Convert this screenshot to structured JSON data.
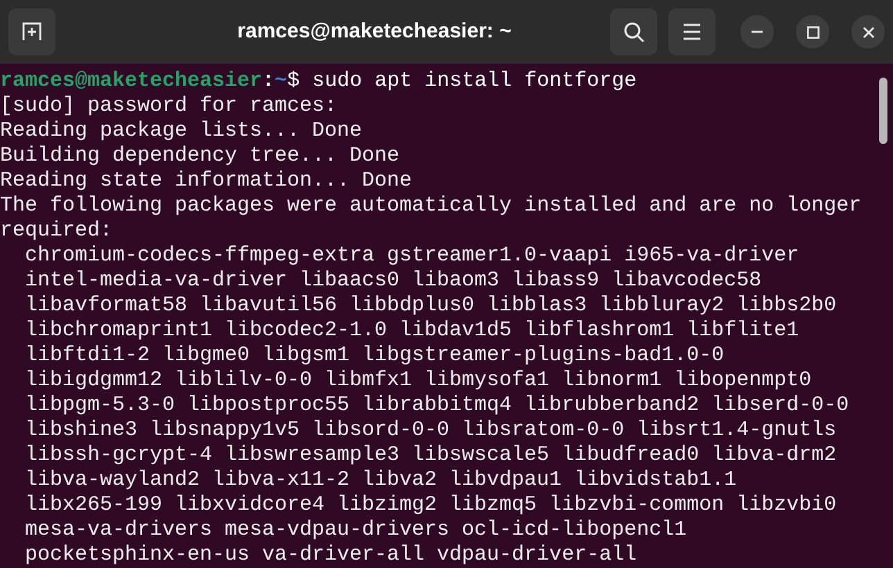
{
  "window": {
    "title": "ramces@maketecheasier: ~"
  },
  "prompt": {
    "user_host": "ramces@maketecheasier",
    "separator": ":",
    "path": "~",
    "symbol": "$",
    "command": "sudo apt install fontforge"
  },
  "output_lines": [
    "[sudo] password for ramces:",
    "Reading package lists... Done",
    "Building dependency tree... Done",
    "Reading state information... Done",
    "The following packages were automatically installed and are no longer",
    "required:"
  ],
  "package_lines": [
    "chromium-codecs-ffmpeg-extra gstreamer1.0-vaapi i965-va-driver",
    "intel-media-va-driver libaacs0 libaom3 libass9 libavcodec58",
    "libavformat58 libavutil56 libbdplus0 libblas3 libbluray2 libbs2b0",
    "libchromaprint1 libcodec2-1.0 libdav1d5 libflashrom1 libflite1",
    "libftdi1-2 libgme0 libgsm1 libgstreamer-plugins-bad1.0-0",
    "libigdgmm12 liblilv-0-0 libmfx1 libmysofa1 libnorm1 libopenmpt0",
    "libpgm-5.3-0 libpostproc55 librabbitmq4 librubberband2 libserd-0-0",
    "libshine3 libsnappy1v5 libsord-0-0 libsratom-0-0 libsrt1.4-gnutls",
    "libssh-gcrypt-4 libswresample3 libswscale5 libudfread0 libva-drm2",
    "libva-wayland2 libva-x11-2 libva2 libvdpau1 libvidstab1.1",
    "libx265-199 libxvidcore4 libzimg2 libzmq5 libzvbi-common libzvbi0",
    "mesa-va-drivers mesa-vdpau-drivers ocl-icd-libopencl1",
    "pocketsphinx-en-us va-driver-all vdpau-driver-all"
  ]
}
